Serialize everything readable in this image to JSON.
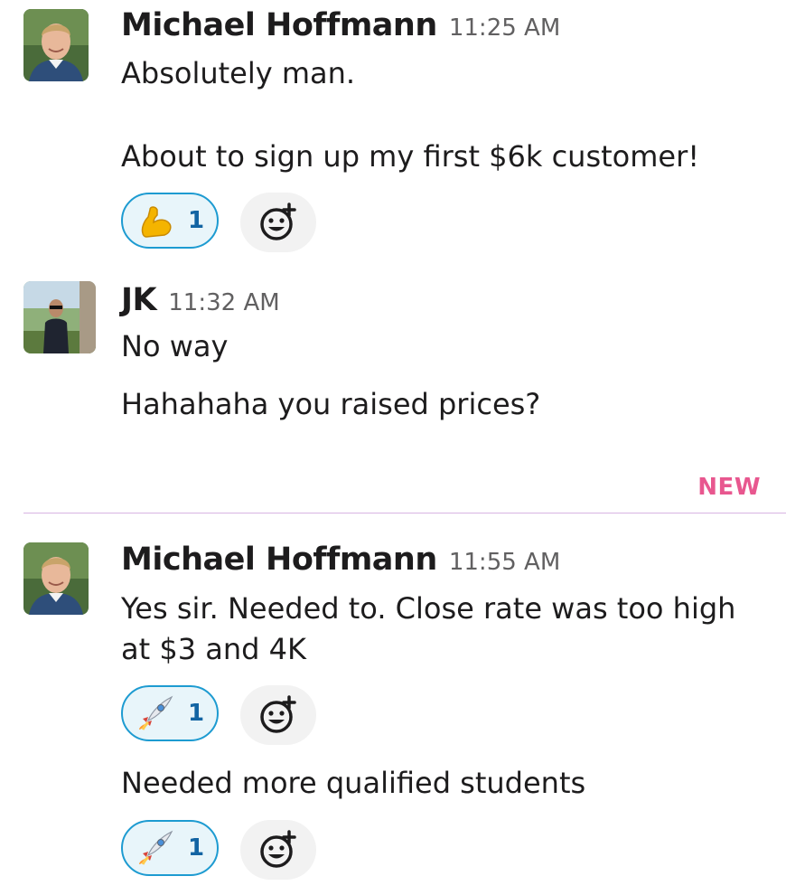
{
  "messages": [
    {
      "author": "Michael Hoffmann",
      "time": "11:25 AM",
      "lines": [
        "Absolutely man.",
        "About to sign up my first $6k customer!"
      ],
      "reaction": {
        "emoji": "flexed-biceps",
        "count": "1"
      }
    },
    {
      "author": "JK",
      "time": "11:32 AM",
      "lines": [
        "No way",
        "Hahahaha you raised prices?"
      ]
    },
    {
      "author": "Michael Hoffmann",
      "time": "11:55 AM",
      "lines": [
        "Yes sir. Needed to. Close rate was too high",
        "at $3 and 4K"
      ],
      "reaction": {
        "emoji": "rocket",
        "count": "1"
      },
      "followup": {
        "text": "Needed more qualified students",
        "reaction": {
          "emoji": "rocket",
          "count": "1"
        }
      }
    }
  ],
  "divider": {
    "label": "NEW",
    "color": "#e8578f"
  },
  "colors": {
    "reaction_border": "#1d9bd1",
    "reaction_bg": "#e8f5fa",
    "count": "#1264a3"
  }
}
